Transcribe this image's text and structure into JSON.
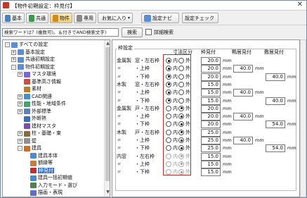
{
  "window": {
    "title": "【物件初期設定：枠見付】"
  },
  "toolbar": {
    "basic": "基本",
    "common": "共通",
    "property": "物件",
    "dedicated": "専用",
    "favorites": "お気に入り",
    "settings_navi": "設定ナビ",
    "settings_check": "設定チェック"
  },
  "search": {
    "placeholder": "検索ワードは？(複数可)。＆付きでAND検索文字)",
    "button": "検索",
    "detail_label": "詳細検索"
  },
  "tree": [
    {
      "label": "すべての設定",
      "level": 0,
      "expander": "−"
    },
    {
      "label": "基本設定",
      "level": 1,
      "expander": "+"
    },
    {
      "label": "共通初期設定",
      "level": 1,
      "expander": "+"
    },
    {
      "label": "物件初期設定",
      "level": 1,
      "expander": "−"
    },
    {
      "label": "マスタ環境",
      "level": 2,
      "expander": "+"
    },
    {
      "label": "基準高さ情報",
      "level": 2,
      "expander": ""
    },
    {
      "label": "素材",
      "level": 2,
      "expander": ""
    },
    {
      "label": "CAD関連",
      "level": 2,
      "expander": "+"
    },
    {
      "label": "性能・地域条件",
      "level": 2,
      "expander": "+"
    },
    {
      "label": "外部標準",
      "level": 2,
      "expander": "+"
    },
    {
      "label": "外断熱",
      "level": 2,
      "expander": ""
    },
    {
      "label": "建材マスタ",
      "level": 2,
      "expander": ""
    },
    {
      "label": "柱・基礎・束",
      "level": 2,
      "expander": "+"
    },
    {
      "label": "壁",
      "level": 2,
      "expander": "+"
    },
    {
      "label": "建具",
      "level": 2,
      "expander": "−"
    },
    {
      "label": "建具本体",
      "level": 3,
      "expander": ""
    },
    {
      "label": "額縁等",
      "level": 3,
      "expander": ""
    },
    {
      "label": "枠見付",
      "level": 3,
      "expander": "",
      "selected": true
    },
    {
      "label": "建具一括初期値",
      "level": 3,
      "expander": ""
    },
    {
      "label": "入力モード・選び",
      "level": 3,
      "expander": ""
    },
    {
      "label": "描画・表現",
      "level": 3,
      "expander": ""
    }
  ],
  "panel": {
    "group_title": "枠設定",
    "headers": {
      "dimension": "寸法区分",
      "frame": "枠見付",
      "ceiling_frame": "鴨居見付",
      "threshold_frame": "敷居見付"
    },
    "inner_label": "内",
    "outer_label": "外",
    "unit": "mm",
    "rows": [
      {
        "cat": "金属製",
        "item": "窓・左右枠",
        "dim": "inner",
        "frame": "20.0",
        "ceil": "",
        "thr": "",
        "enabled": true
      },
      {
        "cat": "〃",
        "item": "・上枠",
        "dim": "inner",
        "frame": "20.0",
        "ceil": "40.0",
        "thr": "",
        "enabled": true
      },
      {
        "cat": "〃",
        "item": "・下枠",
        "dim": "inner",
        "frame": "20.0",
        "ceil": "",
        "thr": "40.0",
        "enabled": true
      },
      {
        "cat": "木製",
        "item": "窓・左右枠",
        "dim": "inner",
        "frame": "15.0",
        "ceil": "",
        "thr": "",
        "enabled": true
      },
      {
        "cat": "〃",
        "item": "・上枠",
        "dim": "inner",
        "frame": "15.0",
        "ceil": "40.0",
        "thr": "",
        "enabled": true
      },
      {
        "cat": "〃",
        "item": "・下枠",
        "dim": "inner",
        "frame": "15.0",
        "ceil": "",
        "thr": "40.0",
        "enabled": true
      },
      {
        "cat": "金属製",
        "item": "戸・左右枠",
        "dim": "outer",
        "frame": "20.0",
        "ceil": "",
        "thr": "",
        "enabled": true
      },
      {
        "cat": "〃",
        "item": "・上枠",
        "dim": "outer",
        "frame": "20.0",
        "ceil": "40.0",
        "thr": "",
        "enabled": true
      },
      {
        "cat": "〃",
        "item": "・下枠",
        "dim": "outer",
        "frame": "20.0",
        "ceil": "",
        "thr": "54.0",
        "enabled": true
      },
      {
        "cat": "木製",
        "item": "戸・左右枠",
        "dim": "outer",
        "frame": "25.0",
        "ceil": "",
        "thr": "",
        "enabled": true
      },
      {
        "cat": "〃",
        "item": "・上枠",
        "dim": "outer",
        "frame": "25.0",
        "ceil": "40.0",
        "thr": "",
        "enabled": true
      },
      {
        "cat": "〃",
        "item": "・下枠",
        "dim": "outer",
        "frame": "25.0",
        "ceil": "",
        "thr": "54.0",
        "enabled": true
      },
      {
        "cat": "内窓",
        "item": "・左右枠",
        "dim": "outer",
        "frame": "15.0",
        "ceil": "",
        "thr": "",
        "enabled": false
      },
      {
        "cat": "〃",
        "item": "・上枠",
        "dim": "outer",
        "frame": "15.0",
        "ceil": "",
        "thr": "",
        "enabled": false
      },
      {
        "cat": "〃",
        "item": "・下枠",
        "dim": "outer",
        "frame": "15.0",
        "ceil": "",
        "thr": "",
        "enabled": false
      }
    ]
  },
  "colors": {
    "selection": "#3375d6",
    "highlight_box": "#b03030"
  }
}
